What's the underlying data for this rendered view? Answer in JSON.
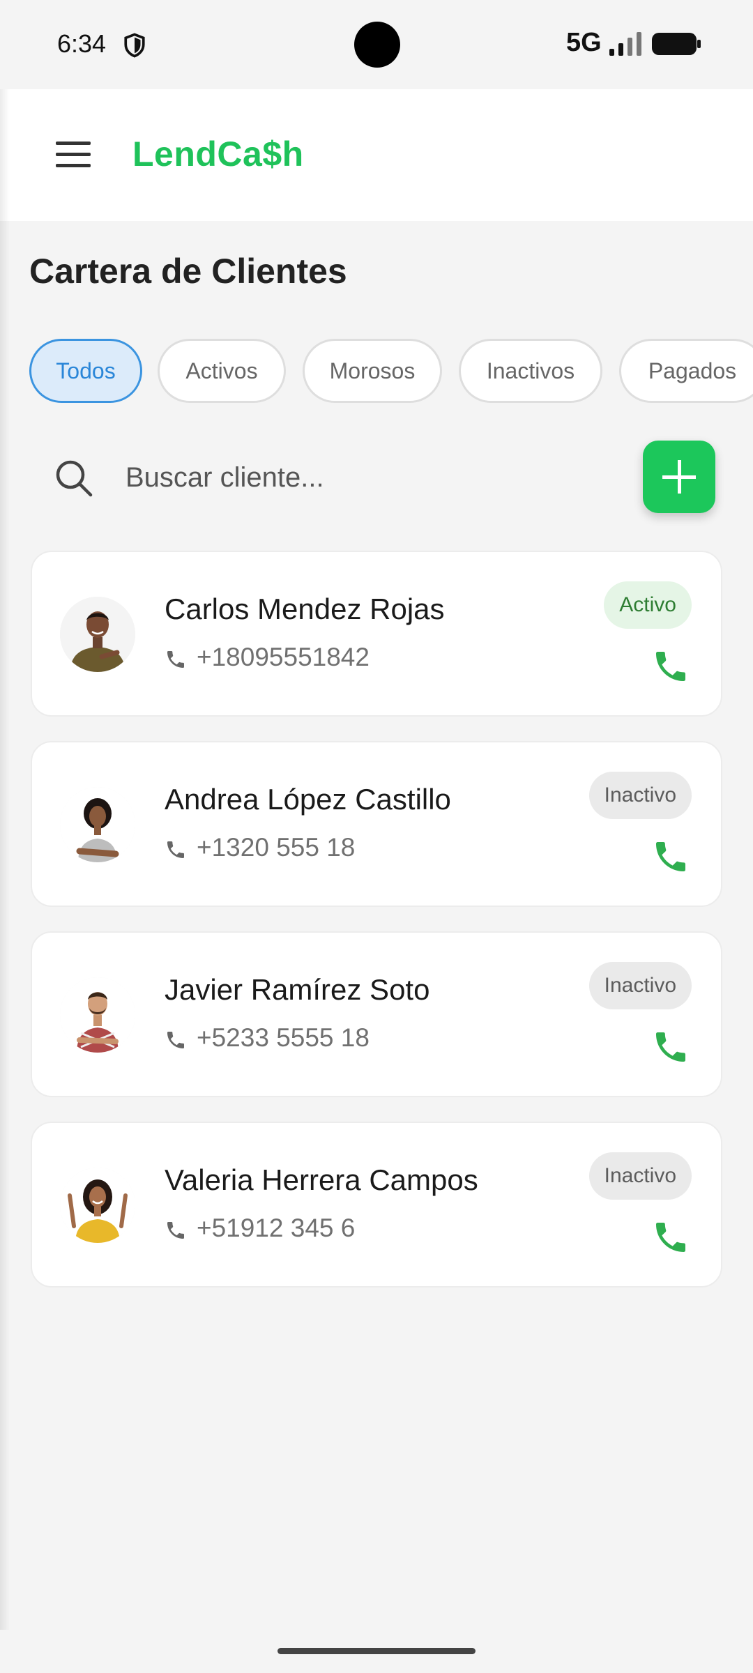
{
  "status_bar": {
    "time": "6:34",
    "network": "5G"
  },
  "app_bar": {
    "title": "LendCa$h"
  },
  "page": {
    "title": "Cartera de Clientes"
  },
  "filters": [
    {
      "label": "Todos",
      "active": true
    },
    {
      "label": "Activos",
      "active": false
    },
    {
      "label": "Morosos",
      "active": false
    },
    {
      "label": "Inactivos",
      "active": false
    },
    {
      "label": "Pagados",
      "active": false
    }
  ],
  "search": {
    "placeholder": "Buscar cliente...",
    "value": ""
  },
  "clients": [
    {
      "name": "Carlos Mendez Rojas",
      "phone": "+18095551842",
      "status": "Activo",
      "status_kind": "activo",
      "avatar": "man-olive-shirt"
    },
    {
      "name": "Andrea López Castillo",
      "phone": "+1320 555 18",
      "status": "Inactivo",
      "status_kind": "inactivo",
      "avatar": "woman-gray-shirt"
    },
    {
      "name": "Javier Ramírez Soto",
      "phone": "+5233 5555 18",
      "status": "Inactivo",
      "status_kind": "inactivo",
      "avatar": "man-plaid-shirt"
    },
    {
      "name": "Valeria Herrera Campos",
      "phone": "+51912 345 6",
      "status": "Inactivo",
      "status_kind": "inactivo",
      "avatar": "woman-yellow-top"
    }
  ],
  "colors": {
    "brand": "#1fc25a",
    "call": "#2fae4f",
    "chip_active_bg": "#dcebfa",
    "chip_active_border": "#3b94e0"
  }
}
